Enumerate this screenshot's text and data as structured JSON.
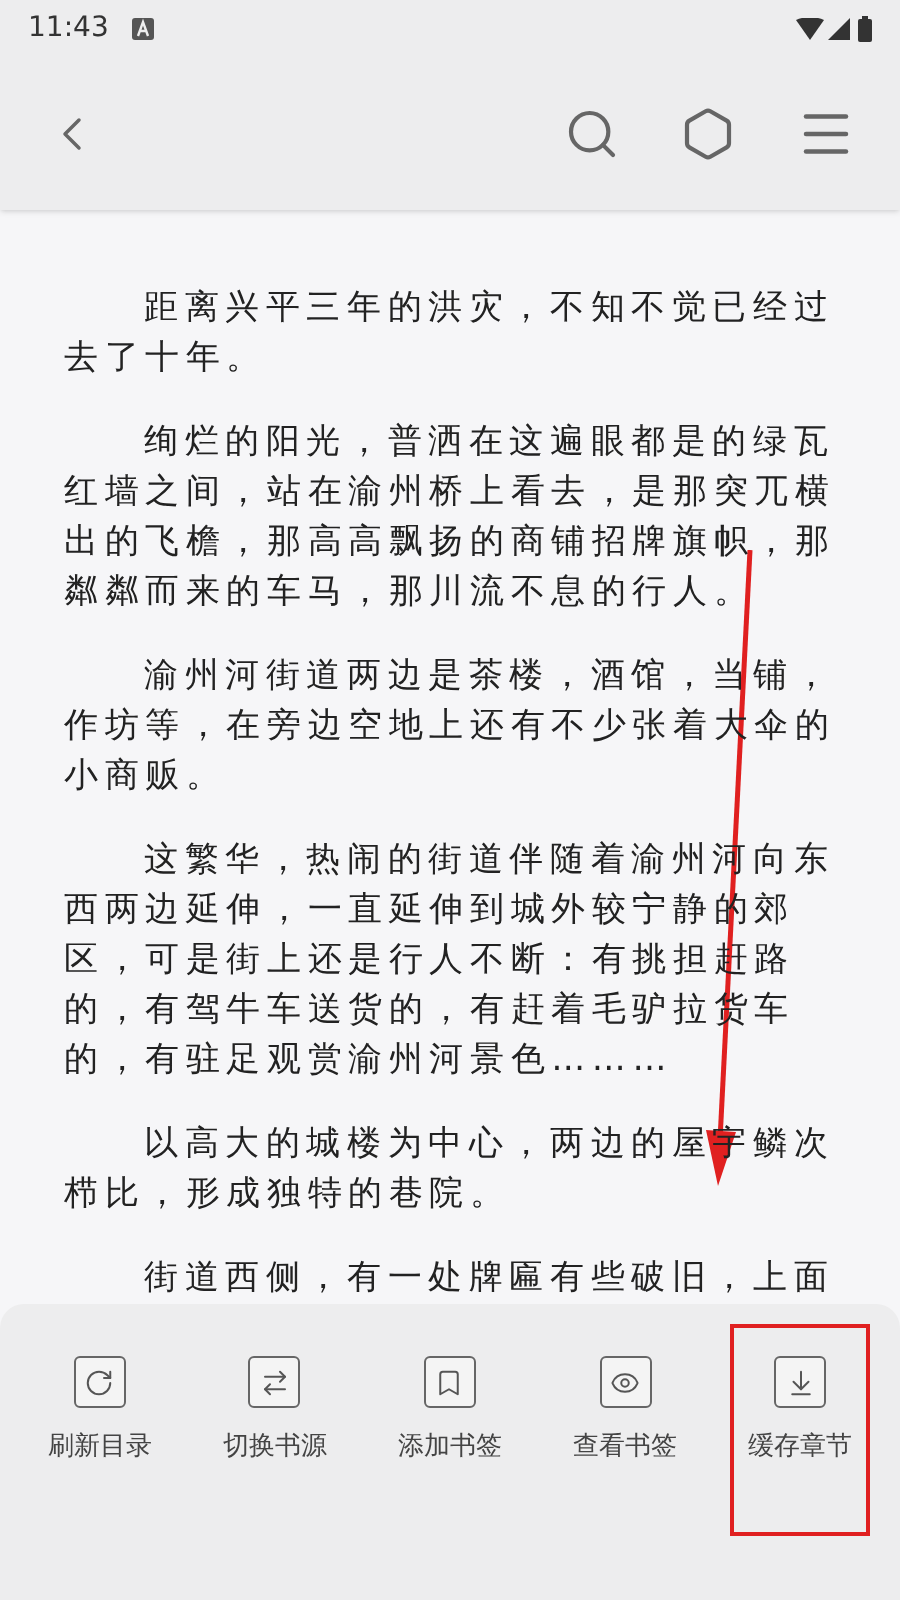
{
  "status_bar": {
    "time": "11:43"
  },
  "paragraphs": [
    "距离兴平三年的洪灾，不知不觉已经过去了十年。",
    "绚烂的阳光，普洒在这遍眼都是的绿瓦红墙之间，站在渝州桥上看去，是那突兀横出的飞檐，那高高飘扬的商铺招牌旗帜，那粼粼而来的车马，那川流不息的行人。",
    "渝州河街道两边是茶楼，酒馆，当铺，作坊等，在旁边空地上还有不少张着大伞的小商贩。",
    "这繁华，热闹的街道伴随着渝州河向东西两边延伸，一直延伸到城外较宁静的郊区，可是街上还是行人不断：有挑担赶路的，有驾牛车送货的，有赶着毛驴拉货车的，有驻足观赏渝州河景色………",
    "以高大的城楼为中心，两边的屋宇鳞次栉比，形成独特的巷院。",
    "街道西侧，有一处牌匾有些破旧，上面"
  ],
  "menu": [
    {
      "kind": "refresh",
      "label": "刷新目录",
      "highlighted": false
    },
    {
      "kind": "swap",
      "label": "切换书源",
      "highlighted": false
    },
    {
      "kind": "bookmark",
      "label": "添加书签",
      "highlighted": false
    },
    {
      "kind": "view",
      "label": "查看书签",
      "highlighted": false
    },
    {
      "kind": "download",
      "label": "缓存章节",
      "highlighted": true
    }
  ]
}
